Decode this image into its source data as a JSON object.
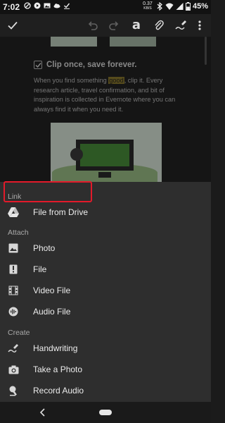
{
  "status_bar": {
    "time": "7:02",
    "speed_value": "0.37",
    "speed_unit": "KB/S",
    "battery": "45%"
  },
  "toolbar": {
    "icons": [
      "check-icon",
      "undo-icon",
      "redo-icon",
      "text-format-icon",
      "attachment-icon",
      "handwriting-icon",
      "more-icon"
    ],
    "format_glyph": "a"
  },
  "note": {
    "heading": "Clip once, save forever.",
    "body_before": "When you find something ",
    "body_highlight": "good",
    "body_after": ", clip it. Every research article, travel confirmation, and bit of inspiration is collected in Evernote where you can always find it when you need it."
  },
  "sheet": {
    "link_label": "Link",
    "attach_label": "Attach",
    "create_label": "Create",
    "link_items": [
      {
        "label": "File from Drive",
        "icon": "drive-icon"
      }
    ],
    "attach_items": [
      {
        "label": "Photo",
        "icon": "photo-icon"
      },
      {
        "label": "File",
        "icon": "file-icon"
      },
      {
        "label": "Video File",
        "icon": "video-file-icon"
      },
      {
        "label": "Audio File",
        "icon": "audio-file-icon"
      }
    ],
    "create_items": [
      {
        "label": "Handwriting",
        "icon": "handwriting-icon"
      },
      {
        "label": "Take a Photo",
        "icon": "camera-icon"
      },
      {
        "label": "Record Audio",
        "icon": "microphone-icon"
      }
    ]
  },
  "colors": {
    "highlight_box": "#e31a2a",
    "sheet_background": "#2e2e2e",
    "section_label": "#a9a9a9"
  }
}
